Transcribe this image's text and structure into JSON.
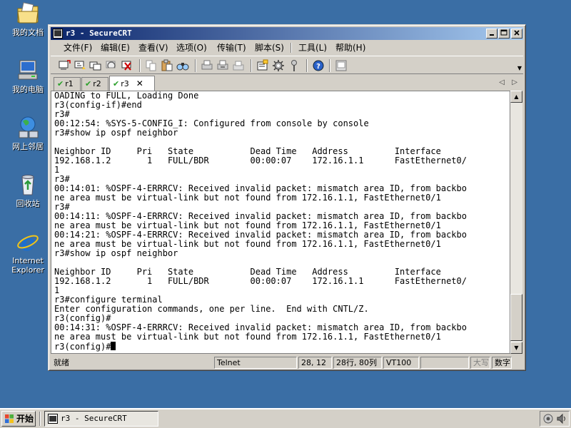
{
  "desktop": {
    "icons": [
      {
        "label": "我的文档",
        "icon": "my-documents-icon"
      },
      {
        "label": "我的电脑",
        "icon": "my-computer-icon"
      },
      {
        "label": "网上邻居",
        "icon": "network-places-icon"
      },
      {
        "label": "回收站",
        "icon": "recycle-bin-icon"
      },
      {
        "label_line1": "Internet",
        "label_line2": "Explorer",
        "icon": "internet-explorer-icon"
      }
    ],
    "background_color": "#3a6ea5"
  },
  "window": {
    "title": "r3 - SecureCRT",
    "menu": [
      "文件(F)",
      "编辑(E)",
      "查看(V)",
      "选项(O)",
      "传输(T)",
      "脚本(S)",
      "工具(L)",
      "帮助(H)"
    ],
    "toolbar_icons": [
      "connect-icon",
      "quick-connect-icon",
      "connect-tab-icon",
      "reconnect-icon",
      "disconnect-icon",
      "copy-icon",
      "paste-icon",
      "find-icon",
      "print-icon",
      "print-selection-icon",
      "print-setup-icon",
      "session-options-icon",
      "global-options-icon",
      "keymap-icon",
      "help-icon",
      "about-icon"
    ],
    "tabs": [
      {
        "label": "r1",
        "active": false
      },
      {
        "label": "r2",
        "active": false
      },
      {
        "label": "r3",
        "active": true,
        "close": "✕"
      }
    ],
    "terminal": {
      "lines": [
        "OADING to FULL, Loading Done",
        "r3(config-if)#end",
        "r3#",
        "00:12:54: %SYS-5-CONFIG_I: Configured from console by console",
        "r3#show ip ospf neighbor",
        "",
        "Neighbor ID     Pri   State           Dead Time   Address         Interface",
        "192.168.1.2       1   FULL/BDR        00:00:07    172.16.1.1      FastEthernet0/",
        "1",
        "r3#",
        "00:14:01: %OSPF-4-ERRRCV: Received invalid packet: mismatch area ID, from backbo",
        "ne area must be virtual-link but not found from 172.16.1.1, FastEthernet0/1",
        "r3#",
        "00:14:11: %OSPF-4-ERRRCV: Received invalid packet: mismatch area ID, from backbo",
        "ne area must be virtual-link but not found from 172.16.1.1, FastEthernet0/1",
        "00:14:21: %OSPF-4-ERRRCV: Received invalid packet: mismatch area ID, from backbo",
        "ne area must be virtual-link but not found from 172.16.1.1, FastEthernet0/1",
        "r3#show ip ospf neighbor",
        "",
        "Neighbor ID     Pri   State           Dead Time   Address         Interface",
        "192.168.1.2       1   FULL/BDR        00:00:07    172.16.1.1      FastEthernet0/",
        "1",
        "r3#configure terminal",
        "Enter configuration commands, one per line.  End with CNTL/Z.",
        "r3(config)#",
        "00:14:31: %OSPF-4-ERRRCV: Received invalid packet: mismatch area ID, from backbo",
        "ne area must be virtual-link but not found from 172.16.1.1, FastEthernet0/1"
      ],
      "prompt": "r3(config)#"
    },
    "status": {
      "ready": "就绪",
      "protocol": "Telnet",
      "cursor_pos": "28, 12",
      "size": "28行, 80列",
      "emulation": "VT100",
      "caps": "大写",
      "num": "数字"
    }
  },
  "taskbar": {
    "start_label": "开始",
    "task_label": "r3 - SecureCRT"
  }
}
